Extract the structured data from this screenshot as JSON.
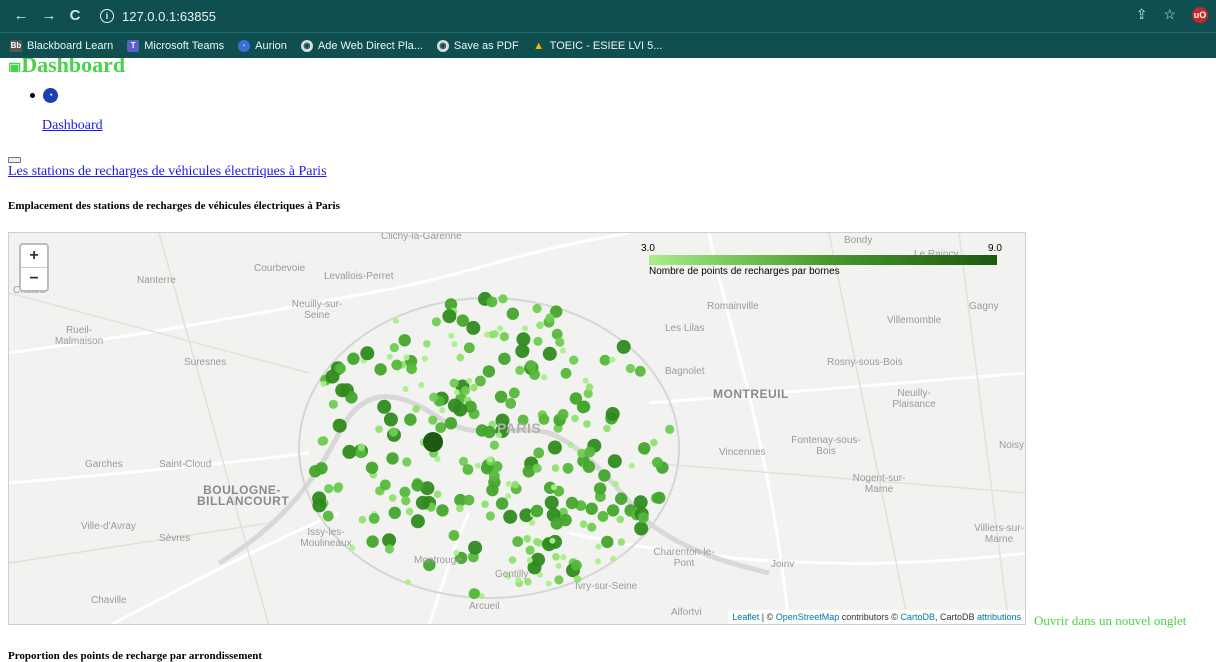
{
  "browser": {
    "url": "127.0.0.1:63855",
    "bookmarks": [
      {
        "label": "Blackboard Learn",
        "icon": "blackboard-icon",
        "color": "#555555"
      },
      {
        "label": "Microsoft Teams",
        "icon": "teams-icon",
        "color": "#5b5fc7"
      },
      {
        "label": "Aurion",
        "icon": "aurion-icon",
        "color": "#3a6fd8"
      },
      {
        "label": "Ade Web Direct Pla...",
        "icon": "globe-icon",
        "color": "#dddddd"
      },
      {
        "label": "Save as PDF",
        "icon": "globe-icon",
        "color": "#dddddd"
      },
      {
        "label": "TOEIC - ESIEE LVI 5...",
        "icon": "drive-icon",
        "color": "#f4b400"
      }
    ]
  },
  "page": {
    "title": "Dashboard",
    "nav_link": "Dashboard",
    "stations_link": "Les stations de recharges de véhicules électriques à Paris",
    "map_heading": "Emplacement des stations de recharges de véhicules électriques à Paris",
    "proportion_heading": "Proportion des points de recharge par arrondissement",
    "open_new_tab": "Ouvrir dans un nouvel onglet"
  },
  "map": {
    "zoom_in": "+",
    "zoom_out": "−",
    "legend": {
      "min": "3.0",
      "max": "9.0",
      "title": "Nombre de points de recharges par bornes",
      "color_min": "#a8ef8a",
      "color_max": "#1b5a10"
    },
    "attribution": {
      "leaflet": "Leaflet",
      "osm": "OpenStreetMap",
      "contrib": " contributors © ",
      "carto": "CartoDB",
      "carto_suffix": ", CartoDB ",
      "attr": "attributions"
    },
    "places": [
      {
        "name": "Clichy-la-Garenne"
      },
      {
        "name": "Bondy"
      },
      {
        "name": "Le Raincy"
      },
      {
        "name": "Courbevoie"
      },
      {
        "name": "Levallois-Perret"
      },
      {
        "name": "Nanterre"
      },
      {
        "name": "Chatou"
      },
      {
        "name": "Neuilly-sur-Seine"
      },
      {
        "name": "Romainville"
      },
      {
        "name": "Gagny"
      },
      {
        "name": "Villemomble"
      },
      {
        "name": "Les Lilas"
      },
      {
        "name": "Rueil-Malmaison"
      },
      {
        "name": "Suresnes"
      },
      {
        "name": "Rosny-sous-Bois"
      },
      {
        "name": "Bagnolet"
      },
      {
        "name": "MONTREUIL"
      },
      {
        "name": "Neuilly-Plaisance"
      },
      {
        "name": "PARIS"
      },
      {
        "name": "Fontenay-sous-Bois"
      },
      {
        "name": "Vincennes"
      },
      {
        "name": "Noisy-"
      },
      {
        "name": "Garches"
      },
      {
        "name": "Saint-Cloud"
      },
      {
        "name": "BOULOGNE-BILLANCOURT"
      },
      {
        "name": "Nogent-sur-Marne"
      },
      {
        "name": "Ville-d'Avray"
      },
      {
        "name": "Sèvres"
      },
      {
        "name": "Issy-les-Moulineaux"
      },
      {
        "name": "Villiers-sur-Marne"
      },
      {
        "name": "Charenton-le-Pont"
      },
      {
        "name": "Joinv"
      },
      {
        "name": "Montrouge"
      },
      {
        "name": "Gentilly"
      },
      {
        "name": "Ivry-sur-Seine"
      },
      {
        "name": "Chaville"
      },
      {
        "name": "Arcueil"
      },
      {
        "name": "Alfortvi"
      }
    ]
  }
}
